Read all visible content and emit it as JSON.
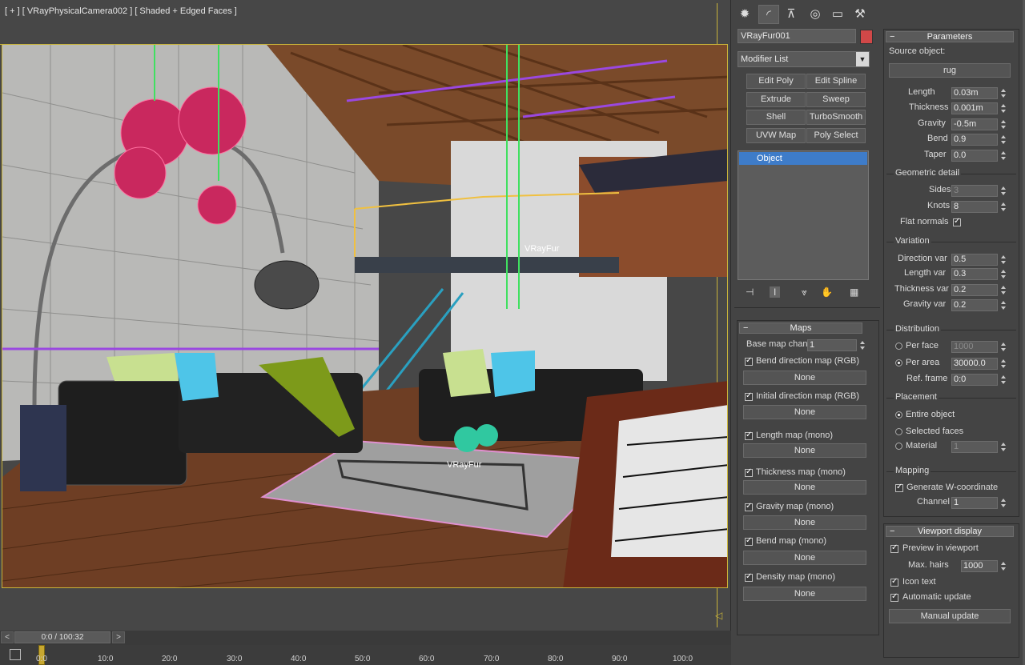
{
  "viewport": {
    "label": "[ + ] [ VRayPhysicalCamera002 ] [ Shaded + Edged Faces ]",
    "fur_label_1": "VRayFur",
    "fur_label_2": "VRayFur"
  },
  "timeline": {
    "prev": "<",
    "next": ">",
    "frame": "0:0 / 100:32",
    "ticks": [
      "0:0",
      "10:0",
      "20:0",
      "30:0",
      "40:0",
      "50:0",
      "60:0",
      "70:0",
      "80:0",
      "90:0",
      "100:0"
    ]
  },
  "tabs": [
    "create-icon",
    "modify-icon",
    "hierarchy-icon",
    "motion-icon",
    "display-icon",
    "utilities-icon"
  ],
  "object": {
    "name": "VRayFur001",
    "color": "#d04848"
  },
  "modifier_list": {
    "label": "Modifier List",
    "buttons": [
      "Edit Poly",
      "Edit Spline",
      "Extrude",
      "Sweep",
      "Shell",
      "TurboSmooth",
      "UVW Map",
      "Poly Select"
    ]
  },
  "stack": {
    "items": [
      "Object"
    ]
  },
  "maps": {
    "title": "Maps",
    "base_map_chan_label": "Base map chan",
    "base_map_chan_value": "1",
    "entries": [
      {
        "label": "Bend direction map (RGB)",
        "value": "None"
      },
      {
        "label": "Initial direction map (RGB)",
        "value": "None"
      },
      {
        "label": "Length map (mono)",
        "value": "None"
      },
      {
        "label": "Thickness map (mono)",
        "value": "None"
      },
      {
        "label": "Gravity map (mono)",
        "value": "None"
      },
      {
        "label": "Bend map (mono)",
        "value": "None"
      },
      {
        "label": "Density map (mono)",
        "value": "None"
      }
    ]
  },
  "parameters": {
    "title": "Parameters",
    "source_label": "Source object:",
    "source_value": "rug",
    "length_label": "Length",
    "length_value": "0.03m",
    "thickness_label": "Thickness",
    "thickness_value": "0.001m",
    "gravity_label": "Gravity",
    "gravity_value": "-0.5m",
    "bend_label": "Bend",
    "bend_value": "0.9",
    "taper_label": "Taper",
    "taper_value": "0.0",
    "geo_title": "Geometric detail",
    "sides_label": "Sides",
    "sides_value": "3",
    "knots_label": "Knots",
    "knots_value": "8",
    "flat_normals_label": "Flat normals",
    "var_title": "Variation",
    "dir_var_label": "Direction var",
    "dir_var_value": "0.5",
    "len_var_label": "Length var",
    "len_var_value": "0.3",
    "thick_var_label": "Thickness var",
    "thick_var_value": "0.2",
    "grav_var_label": "Gravity var",
    "grav_var_value": "0.2",
    "dist_title": "Distribution",
    "per_face_label": "Per face",
    "per_face_value": "1000",
    "per_area_label": "Per area",
    "per_area_value": "30000.0",
    "ref_frame_label": "Ref. frame",
    "ref_frame_value": "0:0",
    "place_title": "Placement",
    "entire_label": "Entire object",
    "selected_label": "Selected faces",
    "material_label": "Material",
    "material_value": "1",
    "map_title": "Mapping",
    "gen_w_label": "Generate W-coordinate",
    "channel_label": "Channel",
    "channel_value": "1"
  },
  "viewport_display": {
    "title": "Viewport display",
    "preview_label": "Preview in viewport",
    "max_hairs_label": "Max. hairs",
    "max_hairs_value": "1000",
    "icon_text_label": "Icon text",
    "auto_update_label": "Automatic update",
    "manual_update_label": "Manual update"
  }
}
